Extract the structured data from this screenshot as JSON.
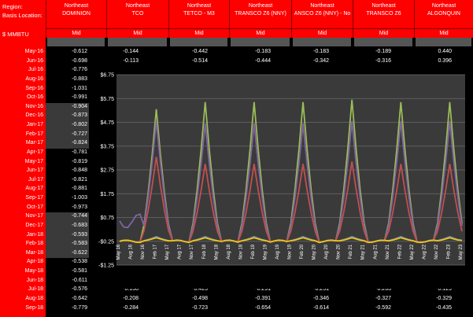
{
  "header": {
    "region_label": "Region:",
    "basis_label": "Basis Location:",
    "unit_label": "$ MMBTU"
  },
  "columns": [
    {
      "region": "Northeast",
      "location": "DOMINION",
      "measure": "Mid"
    },
    {
      "region": "Northeast",
      "location": "TCO",
      "measure": "Mid"
    },
    {
      "region": "Northeast",
      "location": "TETCO - M3",
      "measure": "Mid"
    },
    {
      "region": "Northeast",
      "location": "TRANSCO Z6 (NNY)",
      "measure": "Mid"
    },
    {
      "region": "Northeast",
      "location": "ANSCO Z6 (NNY) - No",
      "measure": "Mid"
    },
    {
      "region": "Northeast",
      "location": "TRANSCO Z6",
      "measure": "Mid"
    },
    {
      "region": "Northeast",
      "location": "ALGONQUIN",
      "measure": "Mid"
    }
  ],
  "dates": [
    "May-16",
    "Jun-16",
    "Jul-16",
    "Aug-16",
    "Sep-16",
    "Oct-16",
    "Nov-16",
    "Dec-16",
    "Jan-17",
    "Feb-17",
    "Mar-17",
    "Apr-17",
    "May-17",
    "Jun-17",
    "Jul-17",
    "Aug-17",
    "Sep-17",
    "Oct-17",
    "Nov-17",
    "Dec-17",
    "Jan-18",
    "Feb-18",
    "Mar-18",
    "Apr-18",
    "May-18",
    "Jun-18",
    "Jul-18",
    "Aug-18",
    "Sep-18"
  ],
  "dominion_values": [
    "-0.612",
    "-0.698",
    "-0.776",
    "-0.883",
    "-1.031",
    "-0.991",
    "-0.904",
    "-0.873",
    "-0.802",
    "-0.727",
    "-0.824",
    "-0.781",
    "-0.819",
    "-0.848",
    "-0.821",
    "-0.881",
    "-1.003",
    "-0.973",
    "-0.744",
    "-0.683",
    "-0.593",
    "-0.583",
    "-0.622",
    "-0.538",
    "-0.581",
    "-0.611",
    "-0.576",
    "-0.642",
    "-0.779"
  ],
  "top_rows": [
    {
      "date": "May-16",
      "values": [
        "-0.144",
        "-0.442",
        "-0.183",
        "-0.183",
        "-0.189",
        "0.440"
      ]
    },
    {
      "date": "Jun-16",
      "values": [
        "-0.113",
        "-0.514",
        "-0.444",
        "-0.342",
        "-0.316",
        "0.396"
      ]
    }
  ],
  "bottom_rows": [
    {
      "date": "Jul-18",
      "values": [
        "-0.138",
        "-0.425",
        "-0.291",
        "-0.251",
        "-0.263",
        "-0.129"
      ]
    },
    {
      "date": "Aug-18",
      "values": [
        "-0.208",
        "-0.498",
        "-0.391",
        "-0.346",
        "-0.327",
        "-0.329"
      ]
    },
    {
      "date": "Sep-18",
      "values": [
        "-0.284",
        "-0.723",
        "-0.654",
        "-0.614",
        "-0.592",
        "-0.435"
      ]
    }
  ],
  "chart_data": {
    "type": "line",
    "y_ticks": [
      "$6.75",
      "$5.75",
      "$4.75",
      "$3.75",
      "$2.75",
      "$1.75",
      "$0.75",
      "-$0.25",
      "-$1.25"
    ],
    "ylim": [
      -1.25,
      6.75
    ],
    "x_ticks": [
      "May 16",
      "Aug 16",
      "Nov 16",
      "Feb 17",
      "May 17",
      "Aug 17",
      "Nov 17",
      "Feb 18",
      "May 18",
      "Aug 18",
      "Nov 18",
      "Feb 19",
      "May 19",
      "Aug 19",
      "Nov 19",
      "Feb 20",
      "May 20",
      "Aug 20",
      "Nov 20",
      "Feb 21",
      "May 21",
      "Aug 21",
      "Nov 21",
      "Feb 22",
      "May 22",
      "Aug 22",
      "Nov 22",
      "Feb 23",
      "May 23"
    ],
    "grid": true,
    "colors": {
      "green": "#9bbb59",
      "purple": "#8064a2",
      "red": "#c0504d",
      "blue": "#4f81bd",
      "yellow": "#f2c314"
    },
    "series": [
      {
        "color": "#9bbb59",
        "peaks": [
          5.3,
          5.6,
          5.6,
          5.6,
          5.7,
          5.6,
          5.6
        ]
      },
      {
        "color": "#8064a2",
        "peaks": [
          4.8,
          4.7,
          4.7,
          4.7,
          4.8,
          4.8,
          4.8
        ]
      },
      {
        "color": "#c0504d",
        "peaks": [
          3.3,
          3.0,
          3.0,
          3.0,
          3.1,
          3.0,
          3.0
        ]
      },
      {
        "color": "#4f81bd",
        "peaks": [
          -0.05,
          -0.05,
          -0.05,
          -0.05,
          -0.05,
          -0.05,
          -0.05
        ]
      },
      {
        "color": "#f2c314",
        "peaks": [
          -0.1,
          -0.1,
          -0.1,
          -0.1,
          -0.1,
          -0.1,
          -0.1
        ]
      }
    ]
  }
}
